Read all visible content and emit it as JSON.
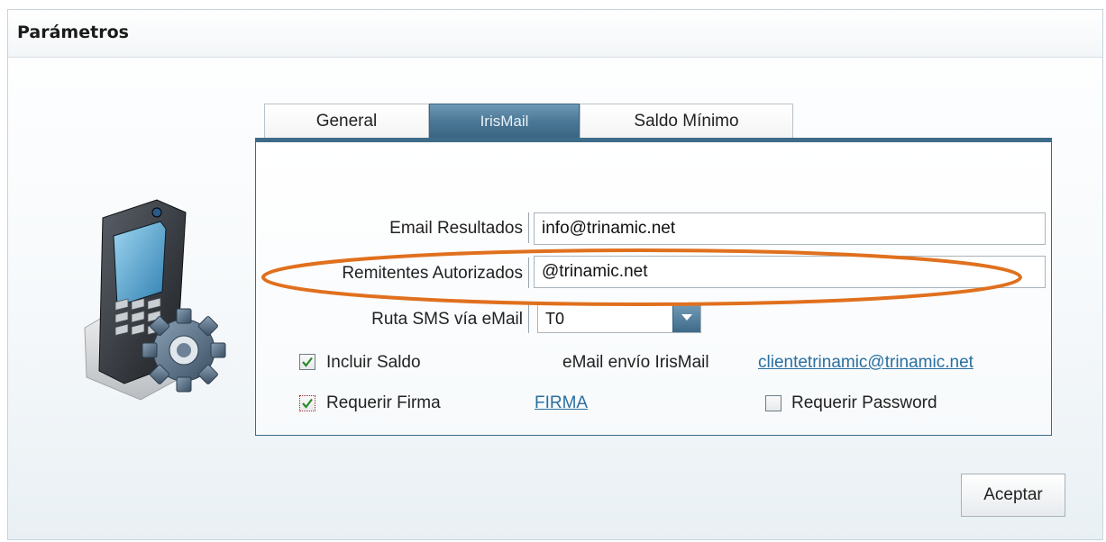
{
  "window": {
    "title": "Parámetros"
  },
  "tabs": [
    {
      "label": "General",
      "active": false
    },
    {
      "label": "IrisMail",
      "active": true
    },
    {
      "label": "Saldo Mínimo",
      "active": false
    }
  ],
  "form": {
    "email_resultados": {
      "label": "Email Resultados",
      "value": "info@trinamic.net"
    },
    "remitentes_autorizados": {
      "label": "Remitentes Autorizados",
      "value": "@trinamic.net"
    },
    "ruta_sms": {
      "label": "Ruta SMS vía eMail",
      "value": "T0"
    },
    "incluir_saldo": {
      "label": "Incluir Saldo",
      "checked": true
    },
    "email_envio": {
      "label": "eMail envío IrisMail",
      "link": "clientetrinamic@trinamic.net"
    },
    "requerir_firma": {
      "label": "Requerir Firma",
      "checked": true
    },
    "firma_link": "FIRMA",
    "requerir_password": {
      "label": "Requerir Password",
      "checked": false
    }
  },
  "buttons": {
    "accept": "Aceptar"
  },
  "icons": {
    "phone_gear": "phone-gear-icon",
    "checkmark": "checkmark-icon",
    "dropdown": "chevron-down-icon"
  },
  "colors": {
    "tab_active": "#4b7896",
    "panel_border": "#3d6b88",
    "link": "#2a6fa0",
    "highlight_ring": "#e0701e"
  }
}
